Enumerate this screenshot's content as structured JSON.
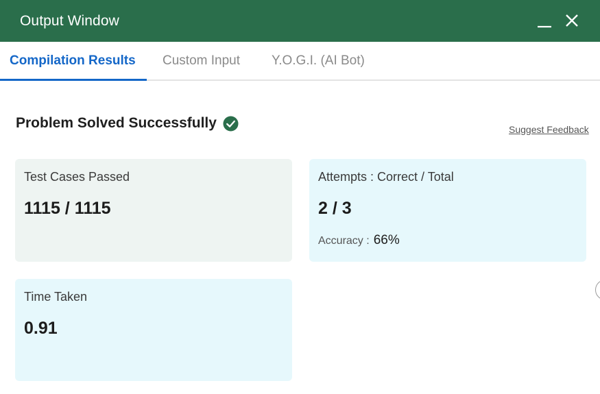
{
  "window": {
    "title": "Output Window",
    "minimize_icon": "minimize-icon",
    "close_icon": "close-icon",
    "header_color": "#2a6e4b"
  },
  "tabs": [
    {
      "label": "Compilation Results",
      "active": true
    },
    {
      "label": "Custom Input",
      "active": false
    },
    {
      "label": "Y.O.G.I. (AI Bot)",
      "active": false
    }
  ],
  "result": {
    "heading": "Problem Solved Successfully",
    "status_icon": "check-circle-icon",
    "status_color": "#2a6e4b",
    "feedback_link": "Suggest Feedback"
  },
  "cards": {
    "test_cases": {
      "label": "Test Cases Passed",
      "value": "1115 / 1115"
    },
    "attempts": {
      "label": "Attempts : Correct / Total",
      "value": "2 / 3",
      "accuracy_label": "Accuracy :",
      "accuracy_value": "66%"
    },
    "time_taken": {
      "label": "Time Taken",
      "value": "0.91"
    }
  },
  "accent_color": "#1467c8"
}
